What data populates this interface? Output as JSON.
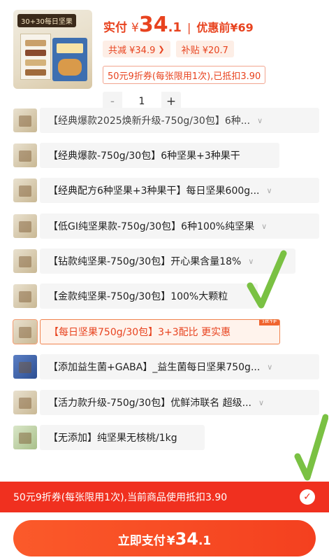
{
  "product": {
    "thumb_tag": "30+30每日坚果"
  },
  "price": {
    "label": "实付",
    "currency": "¥",
    "amount_int": "34",
    "amount_dec": ".1",
    "separator": "|",
    "original_label": "优惠前",
    "original_value": "¥69"
  },
  "discounts": {
    "total_label": "共减 ¥34.9",
    "subsidy_label": "补贴 ¥20.7"
  },
  "coupon_text": "50元9折券(每张限用1次),已抵扣3.90",
  "quantity": {
    "minus": "-",
    "value": "1",
    "plus": "+"
  },
  "options": [
    {
      "label": "【经典爆款2025焕新升级-750g/30包】6种...",
      "chevron": true
    },
    {
      "label": "【经典爆款-750g/30包】6种坚果+3种果干",
      "chevron": false
    },
    {
      "label": "【经典配方6种坚果+3种果干】每日坚果600g...",
      "chevron": true
    },
    {
      "label": "【低GI纯坚果款-750g/30包】6种100%纯坚果",
      "chevron": true
    },
    {
      "label": "【钻款纯坚果-750g/30包】开心果含量18%",
      "chevron": true
    },
    {
      "label": "【金款纯坚果-750g/30包】100%大颗粒",
      "chevron": false
    },
    {
      "label": "【每日坚果750g/30包】3+3配比  更实惠",
      "chevron": false,
      "badge": "推荐"
    },
    {
      "label": "【添加益生菌+GABA】_益生菌每日坚果750g...",
      "chevron": true
    },
    {
      "label": "【活力款升级-750g/30包】优鲜沛联名 超级...",
      "chevron": true
    },
    {
      "label": "【无添加】纯坚果无核桃/1kg",
      "chevron": false
    }
  ],
  "bottom": {
    "coupon_bar_text": "50元9折券(每张限用1次),当前商品使用抵扣3.90",
    "pay_label": "立即支付",
    "pay_currency": "¥",
    "pay_int": "34",
    "pay_dec": ".1"
  },
  "colors": {
    "accent": "#e8431f",
    "coupon_bar": "#f0301f",
    "annotation": "#7ac143"
  }
}
